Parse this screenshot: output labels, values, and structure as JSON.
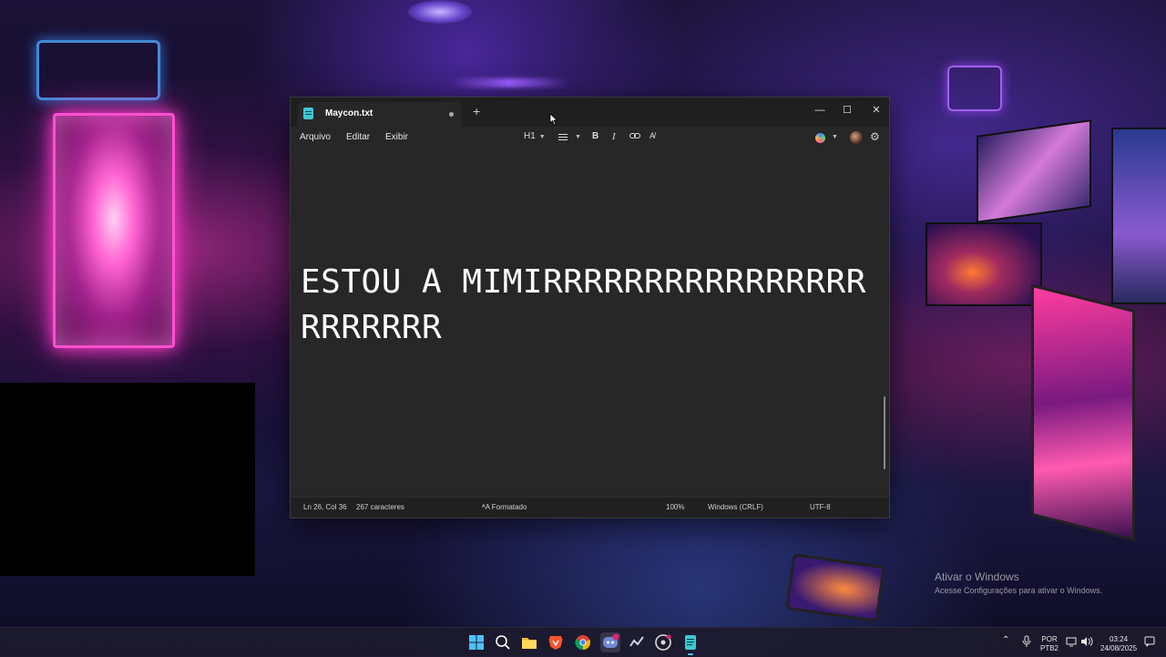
{
  "desktop": {
    "activation": {
      "title": "Ativar o Windows",
      "subtitle": "Acesse Configurações para ativar o Windows."
    }
  },
  "notepad": {
    "tab_title": "Maycon.txt",
    "new_tab_symbol": "+",
    "window_controls": {
      "minimize": "—",
      "maximize": "☐",
      "close": "✕"
    },
    "menu": [
      "Arquivo",
      "Editar",
      "Exibir"
    ],
    "toolbar": {
      "heading_label": "H1",
      "bold": "B",
      "italic": "I",
      "link_icon": "link-icon",
      "clear_format_icon": "clear-formatting-icon"
    },
    "content": "ESTOU A MIMIRRRRRRRRRRRRRRRRRRRRRRR",
    "status": {
      "position": "Ln 26, Col 36",
      "char_count": "267 caracteres",
      "format": "Formatado",
      "zoom": "100%",
      "line_ending": "Windows (CRLF)",
      "encoding": "UTF-8"
    }
  },
  "taskbar": {
    "icons": [
      "windows-start-icon",
      "search-icon",
      "file-explorer-icon",
      "brave-browser-icon",
      "chrome-icon",
      "discord-icon",
      "steam-icon",
      "obs-icon",
      "notepad-icon"
    ],
    "tray": {
      "language_top": "POR",
      "language_bottom": "PTB2",
      "time": "03:24",
      "date": "24/08/2025"
    }
  }
}
